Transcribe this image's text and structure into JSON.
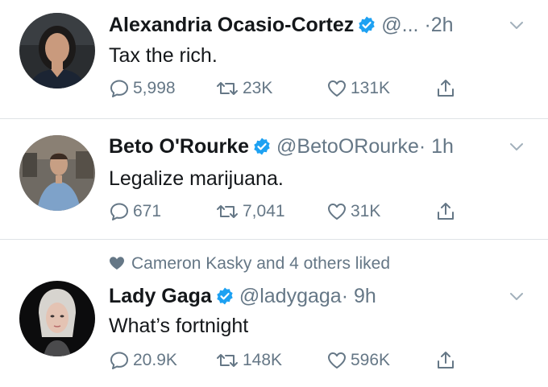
{
  "tweets": [
    {
      "name": "Alexandria Ocasio-Cortez",
      "handle": "@...",
      "time": "2h",
      "text": "Tax the rich.",
      "replies": "5,998",
      "retweets": "23K",
      "likes": "131K"
    },
    {
      "name": "Beto O'Rourke",
      "handle": "@BetoORourke",
      "time": "1h",
      "text": "Legalize marijuana.",
      "replies": "671",
      "retweets": "7,041",
      "likes": "31K"
    },
    {
      "social_context": "Cameron Kasky and 4 others liked",
      "name": "Lady Gaga",
      "handle": "@ladygaga",
      "time": "9h",
      "text": "What’s fortnight",
      "replies": "20.9K",
      "retweets": "148K",
      "likes": "596K"
    }
  ],
  "separator": "·",
  "colors": {
    "verified": "#1da1f2",
    "muted": "#657786",
    "text": "#14171a",
    "divider": "#dfe3e6"
  },
  "icons": [
    "reply-icon",
    "retweet-icon",
    "like-icon",
    "share-icon",
    "verified-badge-icon",
    "chevron-down-icon"
  ]
}
